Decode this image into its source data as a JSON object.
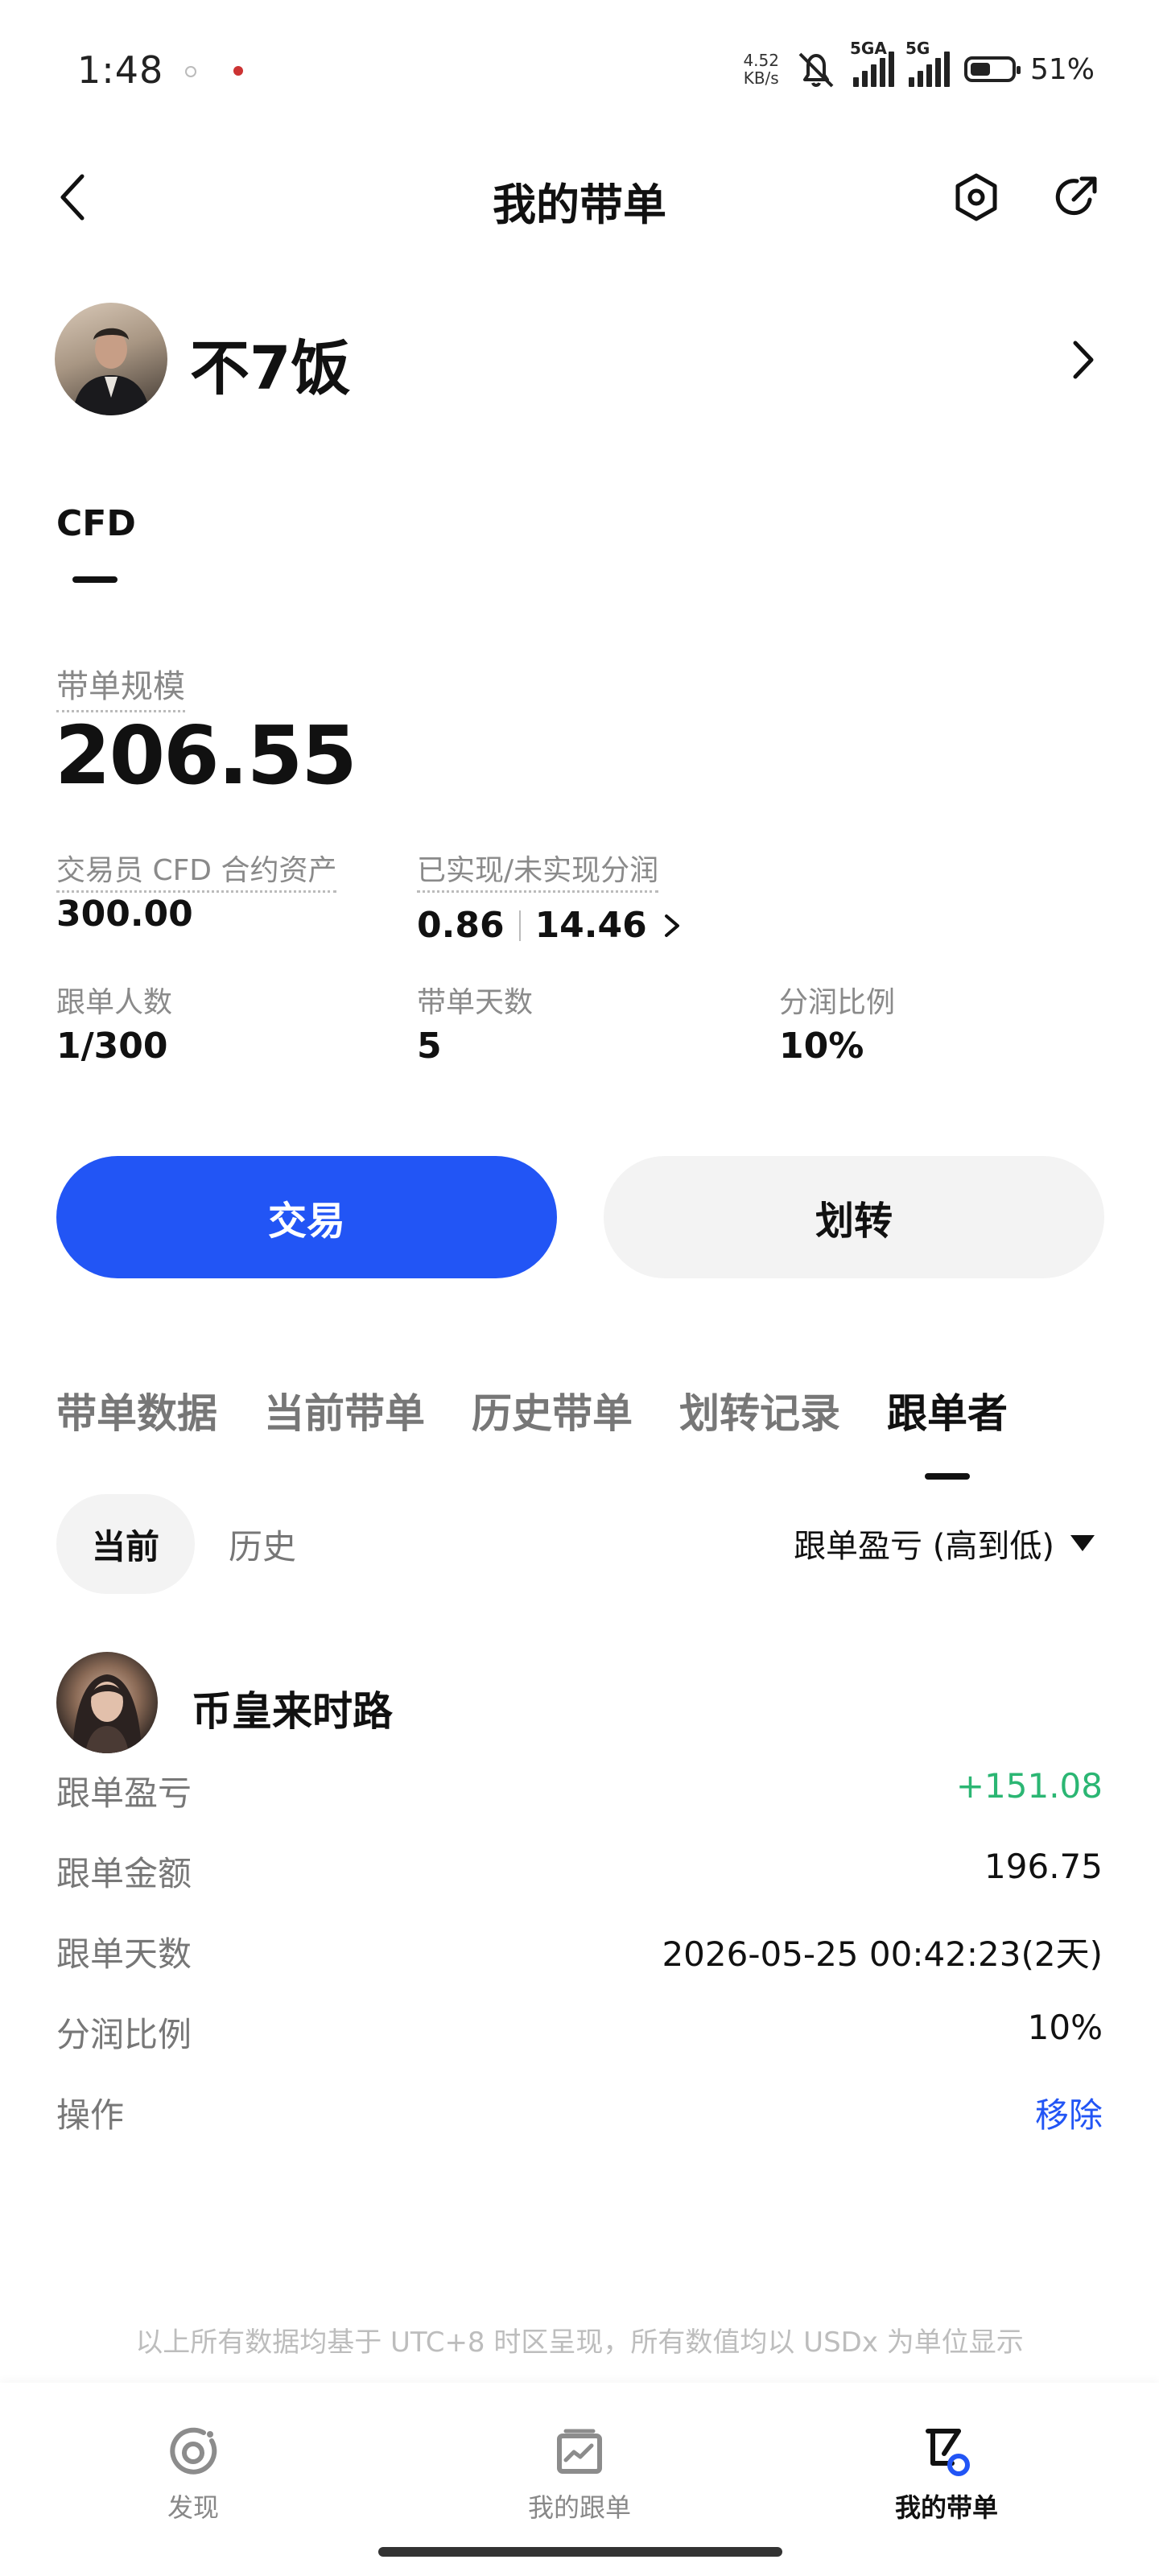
{
  "status_bar": {
    "time": "1:48",
    "net_speed": "4.52",
    "net_unit": "KB/s",
    "signal1_label": "5GA",
    "signal2_label": "5G",
    "battery": "51%",
    "battery_level": 0.51
  },
  "header": {
    "title": "我的带单"
  },
  "profile": {
    "name": "不7饭"
  },
  "category_tab": "CFD",
  "summary": {
    "scale_label": "带单规模",
    "scale_value": "206.55",
    "trader_asset_label": "交易员 CFD 合约资产",
    "trader_asset_value": "300.00",
    "profit_share_label": "已实现/未实现分润",
    "realized": "0.86",
    "unrealized": "14.46",
    "followers_label": "跟单人数",
    "followers_value": "1/300",
    "days_label": "带单天数",
    "days_value": "5",
    "ratio_label": "分润比例",
    "ratio_value": "10%"
  },
  "actions": {
    "trade": "交易",
    "transfer": "划转"
  },
  "section_tabs": [
    {
      "label": "带单数据",
      "active": false
    },
    {
      "label": "当前带单",
      "active": false
    },
    {
      "label": "历史带单",
      "active": false
    },
    {
      "label": "划转记录",
      "active": false
    },
    {
      "label": "跟单者",
      "active": true
    }
  ],
  "filters": {
    "current": "当前",
    "history": "历史",
    "sort": "跟单盈亏 (高到低)"
  },
  "follower": {
    "name": "币皇来时路",
    "rows": [
      {
        "label": "跟单盈亏",
        "value": "+151.08"
      },
      {
        "label": "跟单金额",
        "value": "196.75"
      },
      {
        "label": "跟单天数",
        "value": "2026-05-25 00:42:23(2天)"
      },
      {
        "label": "分润比例",
        "value": "10%"
      },
      {
        "label": "操作",
        "value": "移除"
      }
    ]
  },
  "footer_note": "以上所有数据均基于 UTC+8 时区呈现，所有数值均以 USDx 为单位显示",
  "bottom_nav": [
    {
      "label": "发现",
      "icon": "discover-icon",
      "active": false
    },
    {
      "label": "我的跟单",
      "icon": "chart-board-icon",
      "active": false
    },
    {
      "label": "我的带单",
      "icon": "lead-trading-icon",
      "active": true
    }
  ],
  "colors": {
    "primary": "#2255f5",
    "profit_green": "#2bb673",
    "muted_text": "#777777"
  }
}
